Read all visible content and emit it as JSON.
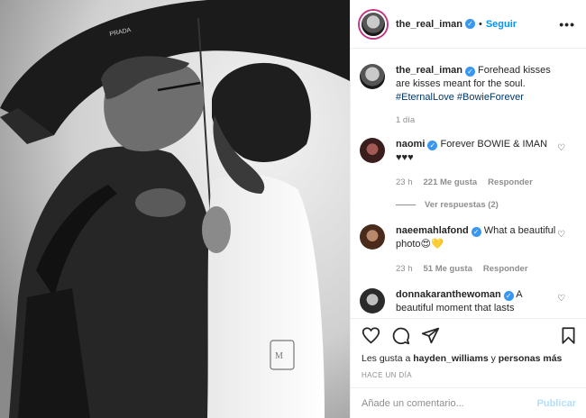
{
  "header": {
    "username": "the_real_iman",
    "follow_label": "Seguir",
    "more_label": "•••"
  },
  "caption": {
    "username": "the_real_iman",
    "text": "Forehead kisses are kisses meant for the soul.",
    "hashtags": "#EternalLove #BowieForever",
    "time": "1 día"
  },
  "comments": [
    {
      "username": "naomi",
      "text": "Forever BOWIE & IMAN ♥♥♥",
      "time": "23 h",
      "likes": "221 Me gusta",
      "reply": "Responder",
      "view_replies": "Ver respuestas (2)"
    },
    {
      "username": "naeemahlafond",
      "text": "What a beautiful photo😍💛",
      "time": "23 h",
      "likes": "51 Me gusta",
      "reply": "Responder"
    },
    {
      "username": "donnakaranthewoman",
      "text": "A beautiful moment that lasts"
    }
  ],
  "likes_line": {
    "prefix": "Les gusta a",
    "user": "hayden_williams",
    "mid": "y",
    "others": "personas más"
  },
  "posted_ago": "HACE UN DÍA",
  "add_comment": {
    "placeholder": "Añade un comentario...",
    "publish_label": "Publicar"
  },
  "photo": {
    "umbrella_brand": "PRADA"
  },
  "colors": {
    "link": "#0095f6",
    "verified": "#3897f0",
    "muted": "#8e8e8e"
  }
}
